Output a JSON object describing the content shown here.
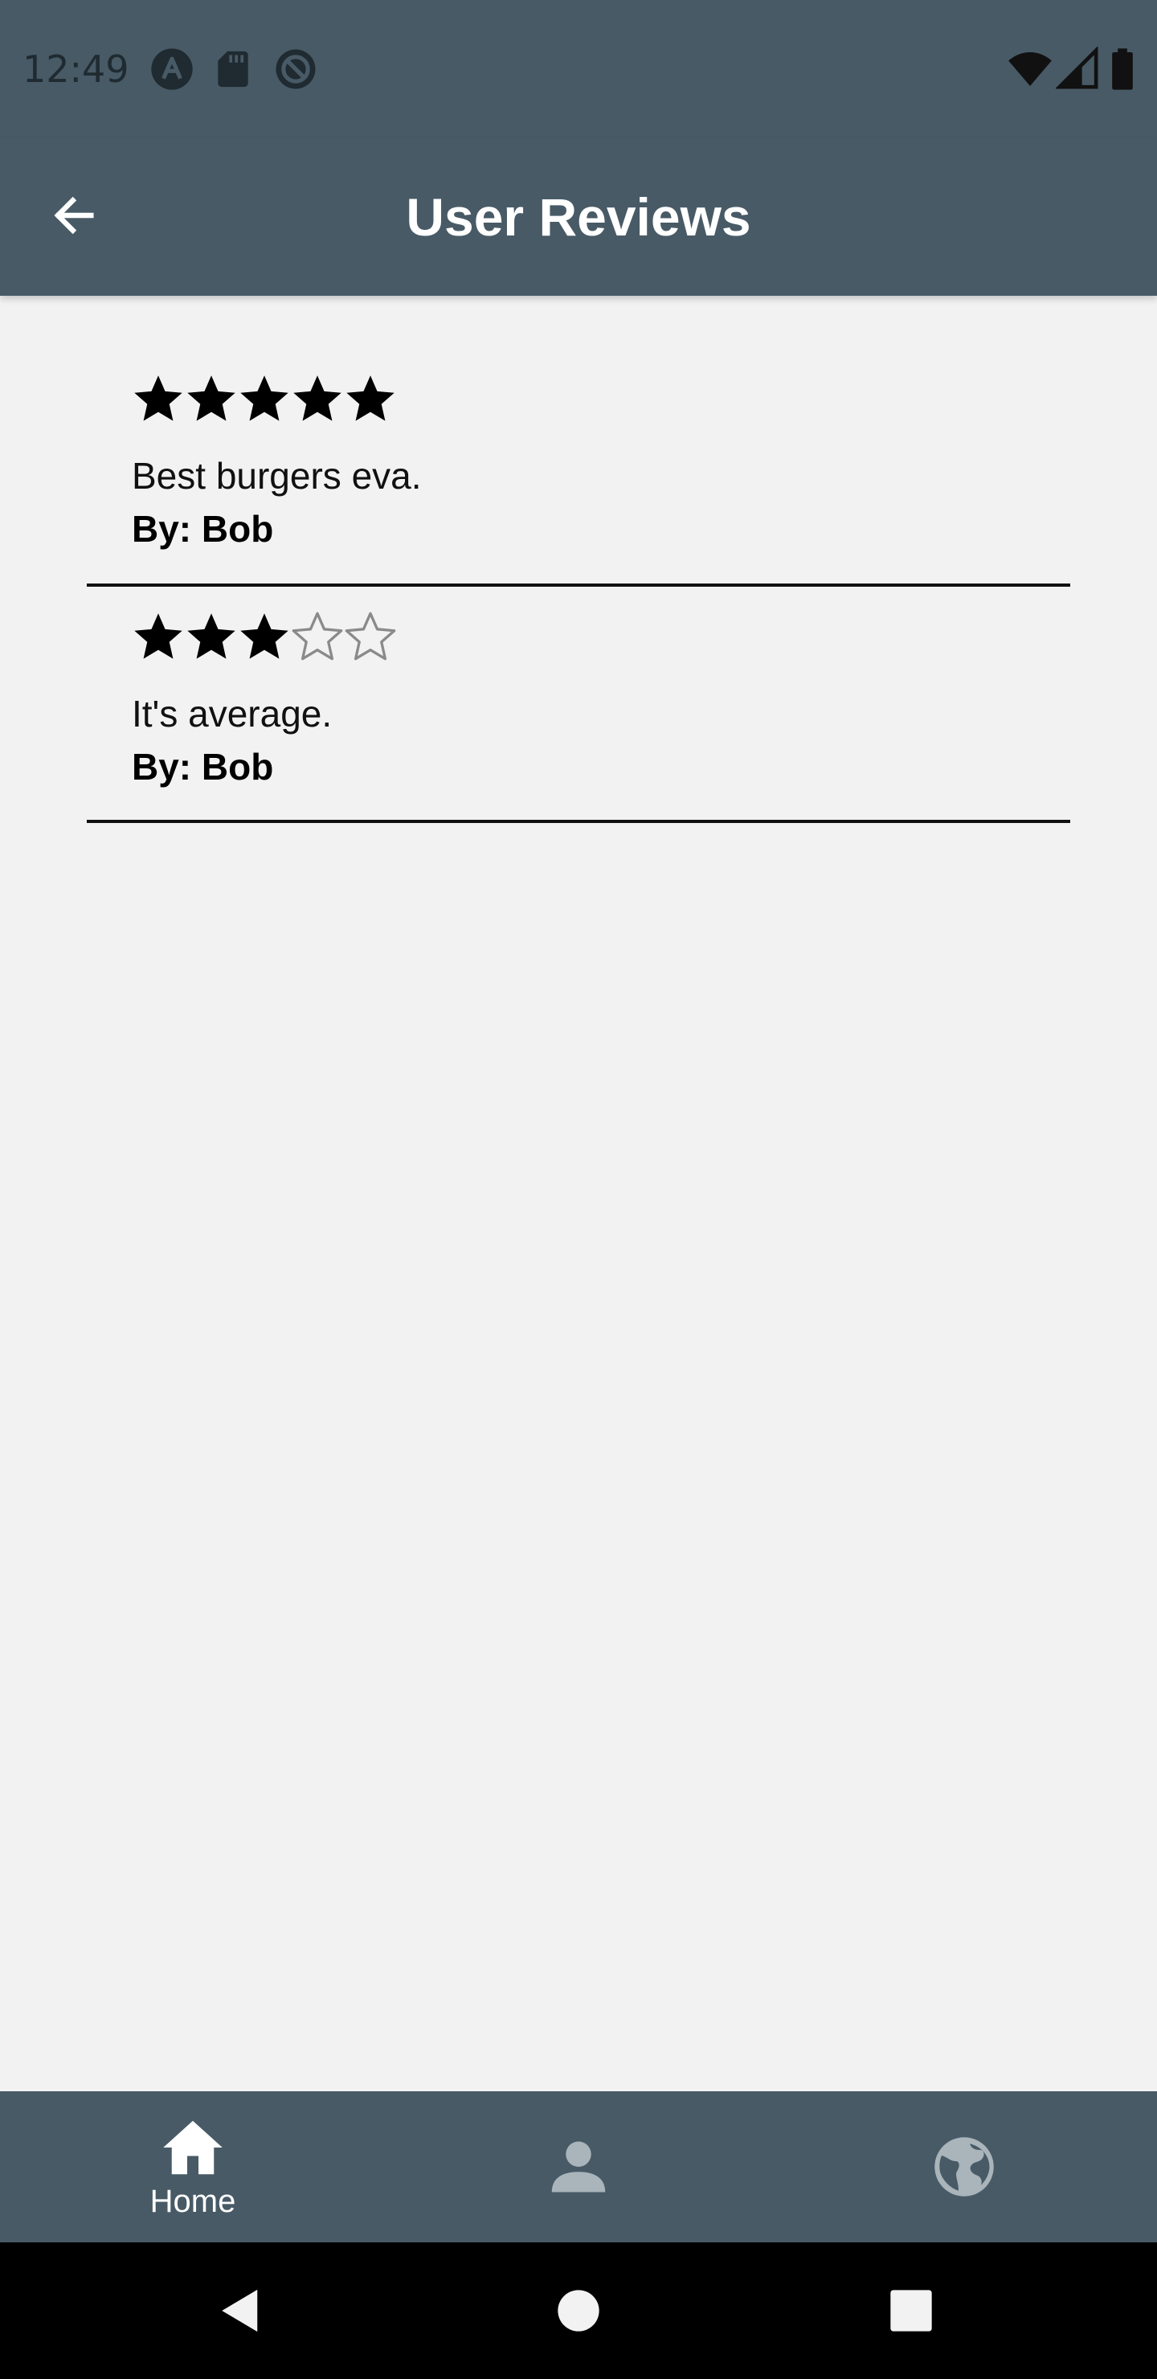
{
  "status_bar": {
    "time": "12:49",
    "left_icons": [
      "app-a-icon",
      "sd-card-icon",
      "do-not-disturb-icon"
    ],
    "right_icons": [
      "wifi-icon",
      "cell-signal-icon",
      "battery-icon"
    ]
  },
  "app_bar": {
    "title": "User Reviews",
    "back_icon": "arrow-left-icon"
  },
  "reviews": [
    {
      "rating": 5,
      "max_rating": 5,
      "text": "Best burgers eva.",
      "author": "By: Bob"
    },
    {
      "rating": 3,
      "max_rating": 5,
      "text": "It's average.",
      "author": "By: Bob"
    }
  ],
  "bottom_nav": {
    "items": [
      {
        "icon": "home-icon",
        "label": "Home",
        "active": true
      },
      {
        "icon": "person-icon",
        "label": "",
        "active": false
      },
      {
        "icon": "globe-icon",
        "label": "",
        "active": false
      }
    ]
  },
  "colors": {
    "bar_background": "#485a66",
    "page_background": "#f2f2f2",
    "star_filled": "#000000",
    "star_empty_outline": "#8a8a8a",
    "inactive_nav_icon": "#a9b4bb"
  }
}
